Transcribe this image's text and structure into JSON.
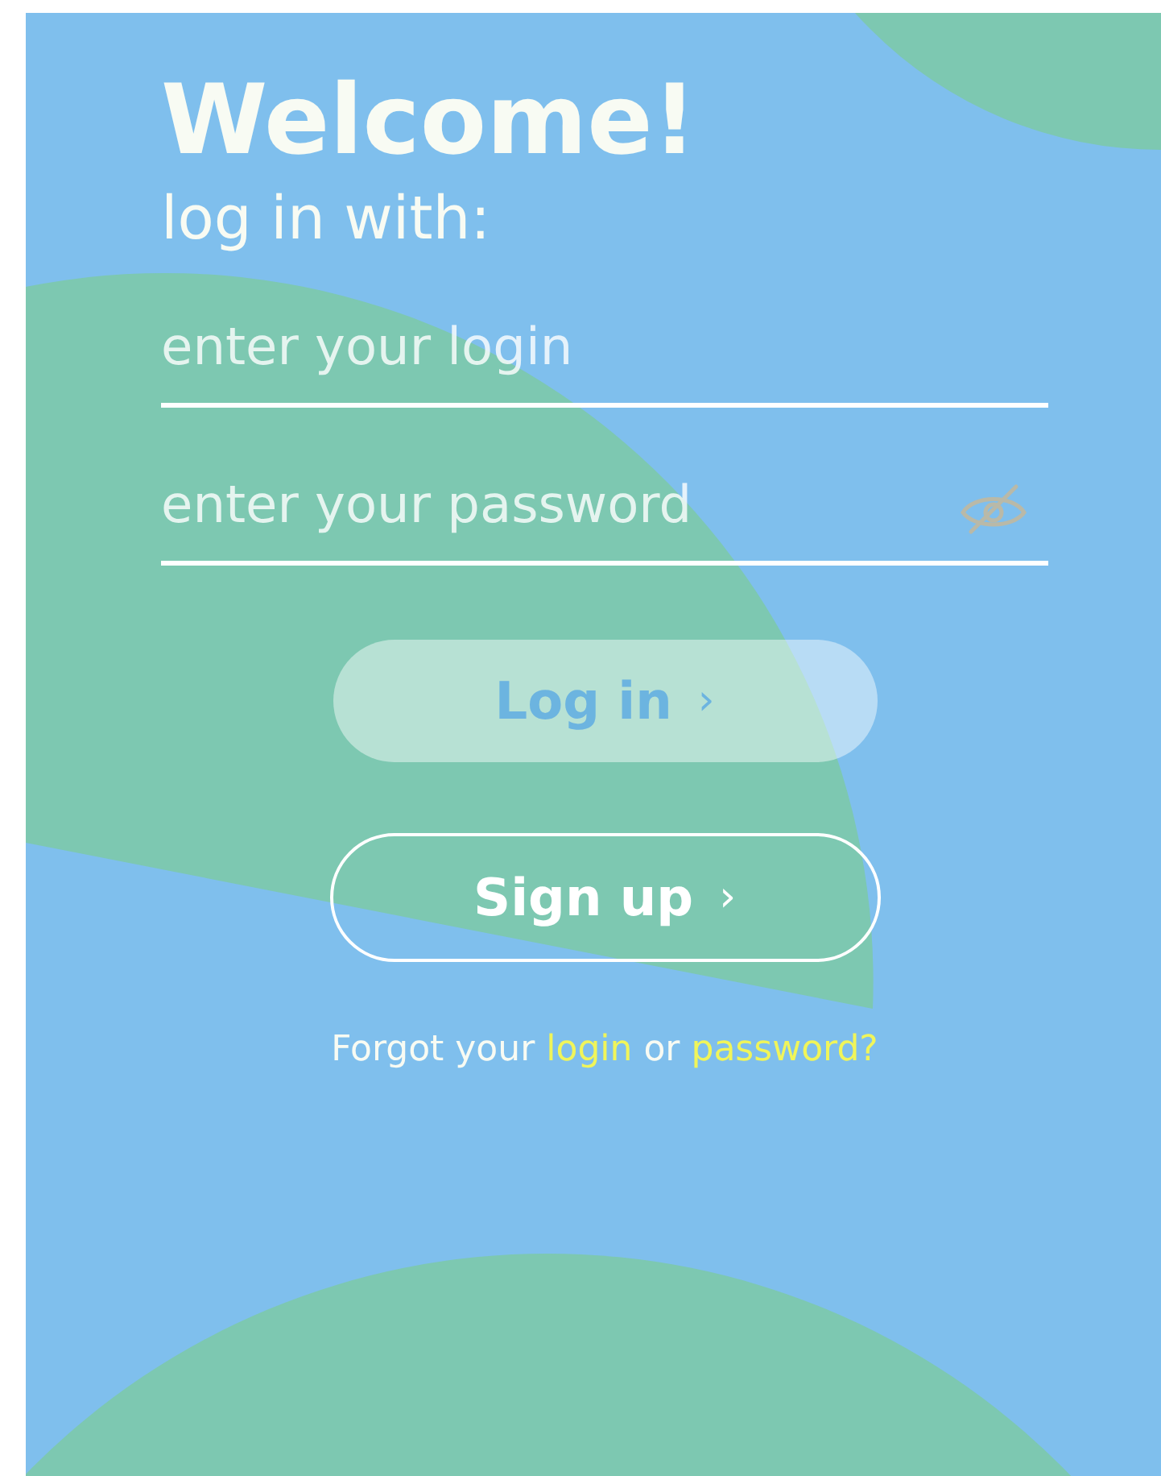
{
  "heading": "Welcome!",
  "subheading": "log in with:",
  "fields": [
    {
      "kind": "text",
      "placeholder": "enter your login"
    },
    {
      "kind": "password",
      "placeholder": "enter your password"
    }
  ],
  "buttons": [
    {
      "kind": "filled",
      "label": "Log in",
      "icon": "›",
      "disabled": true
    },
    {
      "kind": "outline",
      "label": "Sign up",
      "icon": "›",
      "disabled": false
    }
  ],
  "forgot": [
    {
      "kind": "text",
      "text": "Forgot your"
    },
    {
      "kind": "link",
      "text": "login"
    },
    {
      "kind": "text",
      "text": "or"
    },
    {
      "kind": "link",
      "text": "password?"
    }
  ]
}
